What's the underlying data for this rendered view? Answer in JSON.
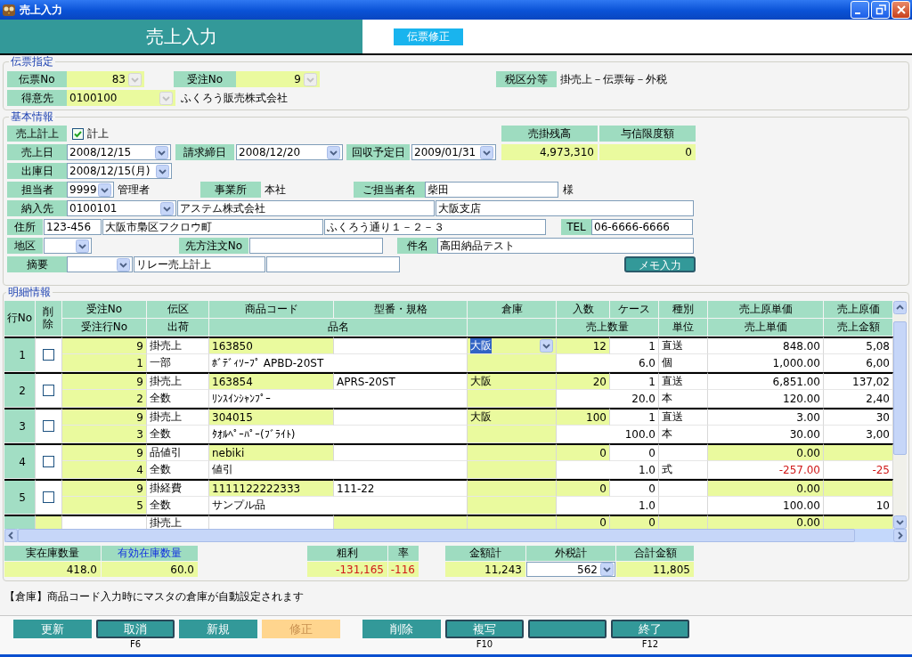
{
  "window": {
    "title": "売上入力"
  },
  "header": {
    "title": "売上入力",
    "mode": "伝票修正"
  },
  "slip": {
    "legend": "伝票指定",
    "slip_no_label": "伝票No",
    "slip_no": "83",
    "order_no_label": "受注No",
    "order_no": "9",
    "tax_label": "税区分等",
    "tax": "掛売上－伝票毎－外税",
    "customer_label": "得意先",
    "customer_code": "0100100",
    "customer_name": "ふくろう販売株式会社"
  },
  "basic": {
    "legend": "基本情報",
    "posting_label": "売上計上",
    "posting": {
      "label": "計上",
      "checked": true
    },
    "balance": {
      "headers": [
        "売掛残高",
        "与信限度額"
      ],
      "values": [
        "4,973,310",
        "0"
      ]
    },
    "sales_date_label": "売上日",
    "sales_date": "2008/12/15",
    "closing_label": "請求締日",
    "closing_date": "2008/12/20",
    "collection_label": "回収予定日",
    "collection_date": "2009/01/31",
    "ship_date_label": "出庫日",
    "ship_date": "2008/12/15(月)",
    "staff_label": "担当者",
    "staff_code": "9999",
    "staff_name": "管理者",
    "office_label": "事業所",
    "office": "本社",
    "contact_label": "ご担当者名",
    "contact": "柴田",
    "honorific": "様",
    "delivery_label": "納入先",
    "delivery_code": "0100101",
    "delivery_name": "アステム株式会社",
    "delivery_branch": "大阪支店",
    "address_label": "住所",
    "zip": "123-456",
    "address1": "大阪市梟区フクロウ町",
    "address2": "ふくろう通り１－２－３",
    "tel_label": "TEL",
    "tel": "06-6666-6666",
    "area_label": "地区",
    "customer_order_label": "先方注文No",
    "subject_label": "件名",
    "subject": "高田納品テスト",
    "summary_label": "摘要",
    "summary": "リレー売上計上",
    "memo_button": "メモ入力"
  },
  "details": {
    "legend": "明細情報",
    "header_top": [
      "行No",
      "削除",
      "受注No",
      "伝区",
      "商品コード",
      "型番・規格",
      "倉庫",
      "入数",
      "ケース",
      "種別",
      "売上原単価",
      "売上原価"
    ],
    "header_bottom": [
      "受注行No",
      "出荷",
      "品名",
      "売上数量",
      "単位",
      "売上単価",
      "売上金額"
    ],
    "rows": [
      {
        "no": "1",
        "deleted": false,
        "selected": true,
        "negative": false,
        "cost_editable": false,
        "order_no": "9",
        "type": "掛売上",
        "code": "163850",
        "warehouse": "大阪",
        "qty_in": "12",
        "cases": "1",
        "kind": "直送",
        "cost_unit": "848.00",
        "cost": "5,08",
        "order_line": "1",
        "shipping": "一部",
        "name": "ﾎﾞﾃﾞｨｿｰﾌﾟ APBD-20ST",
        "sales_qty": "6.0",
        "unit": "個",
        "unit_price": "1,000.00",
        "amount": "6,00"
      },
      {
        "no": "2",
        "deleted": false,
        "selected": false,
        "negative": false,
        "cost_editable": false,
        "order_no": "9",
        "type": "掛売上",
        "code": "163854",
        "model": "APRS-20ST",
        "warehouse": "大阪",
        "qty_in": "20",
        "cases": "1",
        "kind": "直送",
        "cost_unit": "6,851.00",
        "cost": "137,02",
        "order_line": "2",
        "shipping": "全数",
        "name": "ﾘﾝｽｲﾝｼｬﾝﾌﾟｰ",
        "sales_qty": "20.0",
        "unit": "本",
        "unit_price": "120.00",
        "amount": "2,40"
      },
      {
        "no": "3",
        "deleted": false,
        "selected": false,
        "negative": false,
        "cost_editable": false,
        "order_no": "9",
        "type": "掛売上",
        "code": "304015",
        "warehouse": "大阪",
        "qty_in": "100",
        "cases": "1",
        "kind": "直送",
        "cost_unit": "3.00",
        "cost": "30",
        "order_line": "3",
        "shipping": "全数",
        "name": "ﾀｵﾙﾍﾟｰﾊﾟｰ(ﾌﾞﾗｲﾄ)",
        "sales_qty": "100.0",
        "unit": "本",
        "unit_price": "30.00",
        "amount": "3,00"
      },
      {
        "no": "4",
        "deleted": false,
        "selected": false,
        "negative": true,
        "cost_editable": true,
        "order_no": "9",
        "type": "品値引",
        "code": "nebiki",
        "qty_in": "0",
        "cases": "0",
        "cost_unit": "0.00",
        "order_line": "4",
        "shipping": "全数",
        "name": "値引",
        "sales_qty": "1.0",
        "unit": "式",
        "unit_price": "-257.00",
        "amount": "-25"
      },
      {
        "no": "5",
        "deleted": false,
        "selected": false,
        "negative": false,
        "cost_editable": true,
        "order_no": "9",
        "type": "掛経費",
        "code": "1111122222333",
        "model": "111-22",
        "qty_in": "0",
        "cases": "0",
        "cost_unit": "0.00",
        "order_line": "5",
        "shipping": "全数",
        "name": "サンプル品",
        "sales_qty": "1.0",
        "unit_price": "100.00",
        "amount": "10"
      }
    ],
    "new_row": {
      "type": "掛売上",
      "qty_in": "0",
      "cases": "0",
      "cost_unit": "0.00"
    },
    "stock": [
      {
        "label": "実在庫数量",
        "value": "418.0",
        "link": false
      },
      {
        "label": "有効在庫数量",
        "value": "60.0",
        "link": true
      }
    ],
    "profit": [
      {
        "label": "粗利",
        "value": "-131,165",
        "negative": true
      },
      {
        "label": "率",
        "value": "-116",
        "negative": true
      }
    ],
    "amounts": [
      {
        "label": "金額計",
        "value": "11,243",
        "kind": "value"
      },
      {
        "label": "外税計",
        "value": "562",
        "kind": "select"
      },
      {
        "label": "合計金額",
        "value": "11,805",
        "kind": "value"
      }
    ]
  },
  "message": "【倉庫】商品コード入力時にマスタの倉庫が自動設定されます",
  "buttons": [
    {
      "label": "更新",
      "selected": false,
      "framed": false
    },
    {
      "label": "取消",
      "key": "F6",
      "selected": false,
      "framed": true
    },
    {
      "label": "新規",
      "selected": false,
      "framed": false
    },
    {
      "label": "修正",
      "selected": true,
      "framed": false
    },
    {
      "label": "削除",
      "selected": false,
      "framed": false
    },
    {
      "label": "複写",
      "key": "F10",
      "selected": false,
      "framed": true
    },
    {
      "selected": false,
      "framed": true
    },
    {
      "label": "終了",
      "key": "F12",
      "selected": false,
      "framed": true
    }
  ]
}
